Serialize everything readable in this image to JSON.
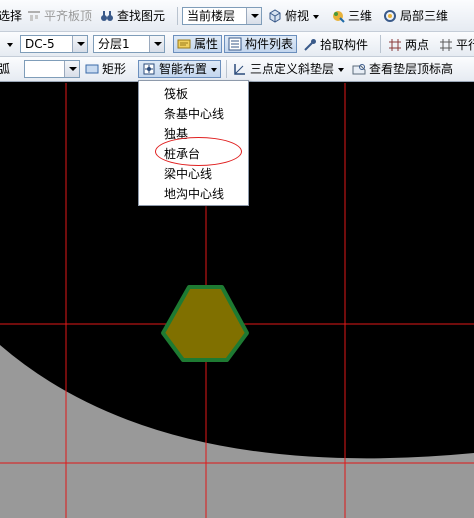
{
  "toolbar1": {
    "select_label": "选择",
    "align_top_label": "平齐板顶",
    "find_label": "查找图元",
    "floor_combo": "当前楼层",
    "view_label": "俯视",
    "threed_label": "三维",
    "local_threed_label": "局部三维"
  },
  "toolbar2": {
    "component_combo": "DC-5",
    "layer_combo": "分层1",
    "properties_label": "属性",
    "component_list_label": "构件列表",
    "pick_label": "拾取构件",
    "two_point_label": "两点",
    "parallel_label": "平行"
  },
  "toolbar3": {
    "left_partial_label": "弧",
    "blank_combo": "",
    "rect_label": "矩形",
    "smart_layout_label": "智能布置",
    "three_point_label": "三点定义斜垫层",
    "view_cushion_label": "查看垫层顶标高"
  },
  "smart_menu": {
    "items": [
      "筏板",
      "条基中心线",
      "独基",
      "桩承台",
      "梁中心线",
      "地沟中心线"
    ]
  },
  "colors": {
    "canvas_bg": "#000000",
    "grid_line": "#e01818",
    "slab_fill": "#999999",
    "pile_cap_fill": "#807000",
    "pile_cap_stroke": "#1e7a32",
    "highlight": "#e02020"
  }
}
